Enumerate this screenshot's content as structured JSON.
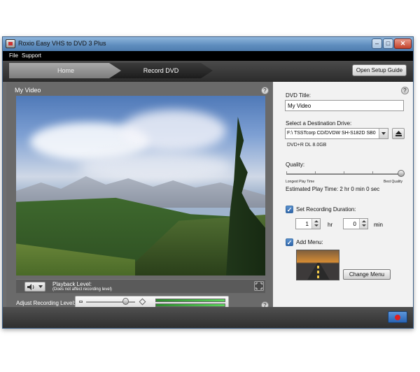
{
  "window": {
    "title": "Roxio Easy VHS to DVD 3 Plus",
    "controls": {
      "minimize": "–",
      "maximize": "□",
      "close": "✕"
    }
  },
  "menubar": {
    "items": [
      {
        "label": "File"
      },
      {
        "label": "Support"
      }
    ]
  },
  "tabs": {
    "home": "Home",
    "record": "Record DVD",
    "active": "Record DVD",
    "setup_guide": "Open Setup Guide"
  },
  "left_panel": {
    "heading": "My Video",
    "help_icon": "?",
    "playback": {
      "label": "Playback Level:",
      "note": "(Does not affect recording level)"
    },
    "recording": {
      "label": "Adjust Recording Level:",
      "level": 0.75,
      "meter_left": 1.0,
      "meter_right": 1.0
    }
  },
  "right_panel": {
    "help_icon": "?",
    "dvd_title_label": "DVD Title:",
    "dvd_title_value": "My Video",
    "destination_label": "Select a Destination Drive:",
    "destination_value": "F:\\ TSSTcorp CD/DVDW SH-S182D SB0",
    "disc_type": "DVD+R DL 8.0GB",
    "quality_label": "Quality:",
    "quality_level": 1.0,
    "quality_min_label": "Longest Play Time",
    "quality_max_label": "Best Quality",
    "estimated_play_time": "Estimated Play Time: 2 hr 0 min 0 sec",
    "set_duration_label": "Set Recording Duration:",
    "set_duration_checked": true,
    "hours_value": "1",
    "hours_unit": "hr",
    "minutes_value": "0",
    "minutes_unit": "min",
    "add_menu_label": "Add Menu:",
    "add_menu_checked": true,
    "change_menu_label": "Change Menu"
  },
  "icons": {
    "app": "app-icon",
    "speaker": "speaker-icon",
    "fullscreen": "fullscreen-icon",
    "eject": "eject-icon",
    "record": "record-icon"
  },
  "colors": {
    "titlebar": "#5e8cbd",
    "record_button": "#2863b3",
    "record_dot": "#e02020",
    "checkbox": "#2e64a8"
  }
}
